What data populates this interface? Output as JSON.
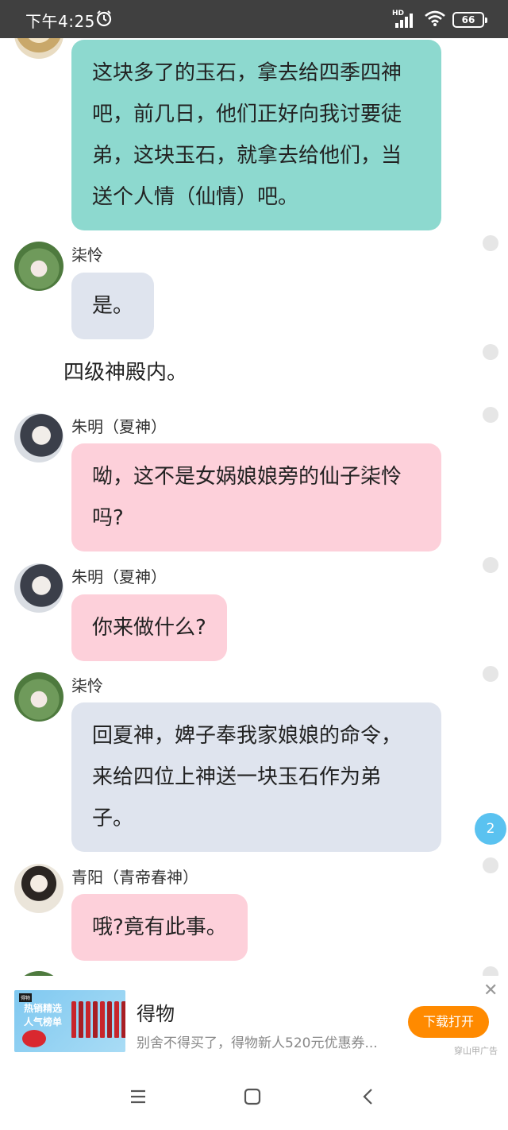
{
  "status_bar": {
    "time": "下午4:25",
    "network": "HD",
    "battery": "66"
  },
  "messages": [
    {
      "type": "bubble",
      "style": "teal",
      "text": "这块多了的玉石，拿去给四季四神吧，前几日，他们正好向我讨要徒弟，这块玉石，就拿去给他们，当送个人情（仙情）吧。"
    },
    {
      "type": "bubble",
      "style": "gray",
      "name": "柒怜",
      "text": "是。"
    },
    {
      "type": "narration",
      "text": "四级神殿内。"
    },
    {
      "type": "bubble",
      "style": "pink",
      "name": "朱明（夏神）",
      "text": "呦，这不是女娲娘娘旁的仙子柒怜吗?"
    },
    {
      "type": "bubble",
      "style": "pink",
      "name": "朱明（夏神）",
      "text": "你来做什么?"
    },
    {
      "type": "bubble",
      "style": "gray",
      "name": "柒怜",
      "text": "回夏神，婢子奉我家娘娘的命令，来给四位上神送一块玉石作为弟子。"
    },
    {
      "type": "bubble",
      "style": "pink",
      "name": "青阳（青帝春神）",
      "text": "哦?竟有此事。"
    }
  ],
  "unread_badge": "2",
  "ad": {
    "image_tag": "得物",
    "image_line1": "热销精选",
    "image_line2": "人气榜单",
    "title": "得物",
    "description": "别舍不得买了，得物新人520元优惠券...",
    "button": "下载打开",
    "close": "✕",
    "source": "穿山甲广告"
  },
  "colors": {
    "teal": "#8dd9cf",
    "gray": "#dfe4ee",
    "pink": "#fdd0da",
    "badge": "#5ac2f0",
    "ad_button": "#ff8a00"
  },
  "icons": [
    "alarm-icon",
    "signal-icon",
    "wifi-icon",
    "battery-icon",
    "menu-icon",
    "home-icon",
    "back-icon"
  ]
}
